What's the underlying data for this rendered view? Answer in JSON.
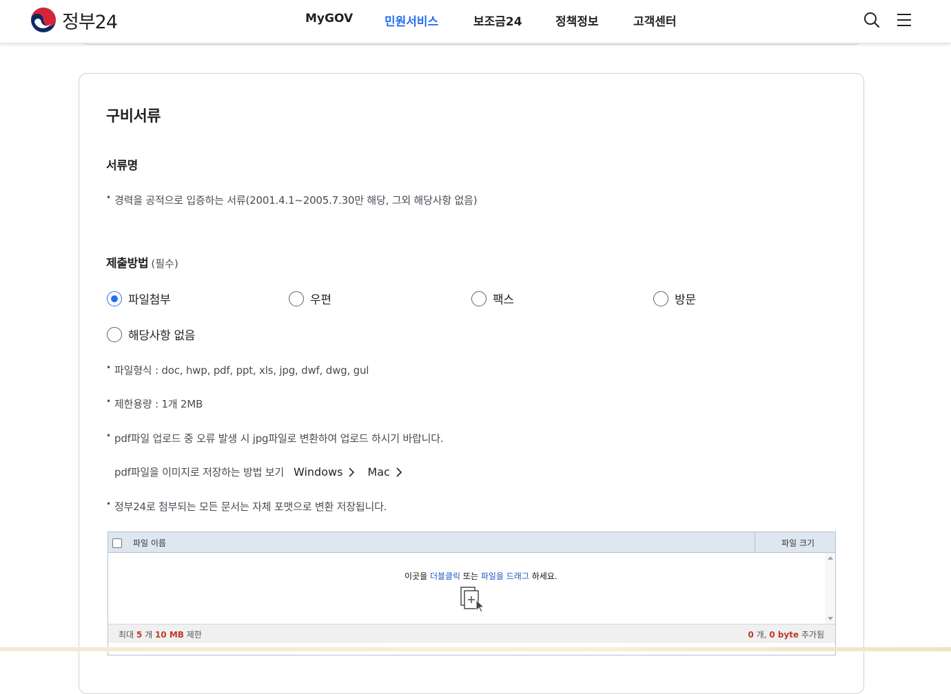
{
  "header": {
    "logo_text": "정부24",
    "nav": [
      {
        "label": "MyGOV",
        "active": false
      },
      {
        "label": "민원서비스",
        "active": true
      },
      {
        "label": "보조금24",
        "active": false
      },
      {
        "label": "정책정보",
        "active": false
      },
      {
        "label": "고객센터",
        "active": false
      }
    ],
    "icons": [
      "search-icon",
      "menu-icon"
    ],
    "accent_color": "#256ef4"
  },
  "section": {
    "title": "구비서류",
    "doc_name_heading": "서류명",
    "doc_name_item": "경력을 공적으로 입증하는 서류(2001.4.1~2005.7.30만 해당, 그외 해당사항 없음)",
    "submit_heading": "제출방법",
    "submit_required": "(필수)",
    "methods": [
      {
        "label": "파일첨부",
        "checked": true
      },
      {
        "label": "우편",
        "checked": false
      },
      {
        "label": "팩스",
        "checked": false
      },
      {
        "label": "방문",
        "checked": false
      },
      {
        "label": "해당사항 없음",
        "checked": false
      }
    ],
    "notes": {
      "file_types": "파일형식 : doc, hwp, pdf, ppt, xls, jpg, dwf, dwg, gul",
      "size_limit": "제한용량 : 1개 2MB",
      "pdf_error": "pdf파일 업로드 중 오류 발생 시 jpg파일로 변환하여 업로드 하시기 바랍니다.",
      "pdf_howto": "pdf파일을 이미지로 저장하는 방법 보기",
      "link_windows": "Windows",
      "link_mac": "Mac",
      "convert_note": "정부24로 첨부되는 모든 문서는 자체 포맷으로 변환 저장됩니다."
    }
  },
  "uploader": {
    "col_name": "파일 이름",
    "col_size": "파일 크기",
    "hint_pre": "이곳을 ",
    "hint_dbl": "더블클릭",
    "hint_mid": " 또는 ",
    "hint_drag": "파일을 드래그",
    "hint_post": " 하세요.",
    "foot_max_pre": "최대 ",
    "foot_max_count": "5",
    "foot_max_mid": " 개 ",
    "foot_max_size": "10 MB",
    "foot_max_post": " 제한",
    "foot_added_count": "0",
    "foot_added_mid": " 개, ",
    "foot_added_size": "0 byte",
    "foot_added_post": " 추가됨"
  }
}
